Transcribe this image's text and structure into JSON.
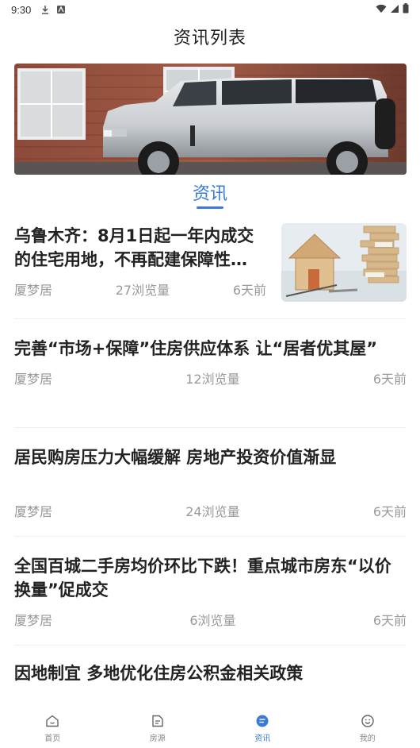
{
  "status_bar": {
    "time": "9:30"
  },
  "header": {
    "title": "资讯列表"
  },
  "section_tab": {
    "label": "资讯"
  },
  "colors": {
    "accent": "#3a7bd5",
    "meta_text": "#999999"
  },
  "news": [
    {
      "title": "乌鲁木齐：8月1日起一年内成交的住宅用地，不再配建保障性…",
      "source": "厦梦居",
      "views": "27浏览量",
      "time": "6天前",
      "has_thumb": true
    },
    {
      "title": "完善“市场+保障”住房供应体系 让“居者优其屋”",
      "source": "厦梦居",
      "views": "12浏览量",
      "time": "6天前"
    },
    {
      "title": "居民购房压力大幅缓解 房地产投资价值渐显",
      "source": "厦梦居",
      "views": "24浏览量",
      "time": "6天前"
    },
    {
      "title": "全国百城二手房均价环比下跌！重点城市房东“以价换量”促成交",
      "source": "厦梦居",
      "views": "6浏览量",
      "time": "6天前"
    },
    {
      "title": "因地制宜 多地优化住房公积金相关政策"
    }
  ],
  "bottom_nav": {
    "items": [
      {
        "label": "首页",
        "icon": "home-icon"
      },
      {
        "label": "房源",
        "icon": "listing-icon"
      },
      {
        "label": "资讯",
        "icon": "news-icon",
        "active": true
      },
      {
        "label": "我的",
        "icon": "profile-icon"
      }
    ]
  }
}
